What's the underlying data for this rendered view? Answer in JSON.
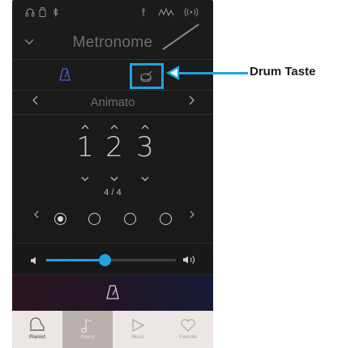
{
  "header": {
    "title": "Metronome"
  },
  "tempo": {
    "name": "Animato"
  },
  "beats": {
    "digits": [
      "1",
      "2",
      "3"
    ],
    "time_signature": "4 / 4"
  },
  "pattern": {
    "selected_index": 0,
    "count": 4
  },
  "volume": {
    "level_percent": 45
  },
  "tabs": [
    {
      "label": "Pianist",
      "icon": "piano-icon",
      "active": false
    },
    {
      "label": "Sound",
      "icon": "music-note-icon",
      "active": true
    },
    {
      "label": "Music",
      "icon": "play-icon",
      "active": false
    },
    {
      "label": "Favorite",
      "icon": "heart-icon",
      "active": false
    }
  ],
  "annotation": {
    "label": "Drum Taste"
  },
  "colors": {
    "accent": "#1fa3e0",
    "screen_bg": "#1a1a1a",
    "tabbar_bg": "#ece7e4",
    "active_tab_bg": "#b8b1ad"
  }
}
